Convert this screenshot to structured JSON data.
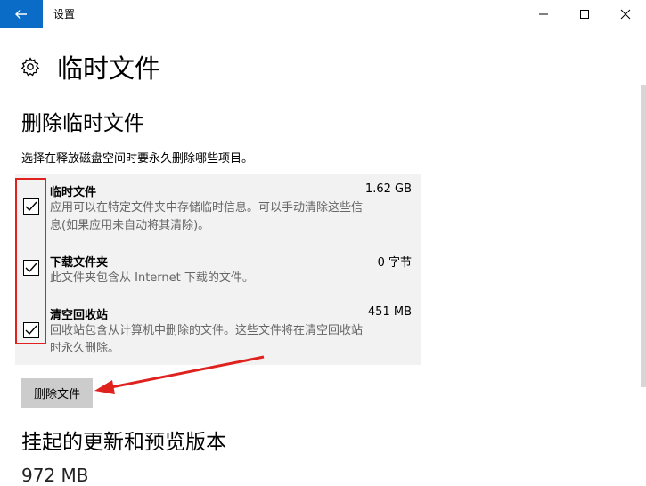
{
  "window": {
    "title": "设置"
  },
  "page": {
    "title": "临时文件"
  },
  "delete_section": {
    "title": "删除临时文件",
    "description": "选择在释放磁盘空间时要永久删除哪些项目。",
    "items": [
      {
        "name": "临时文件",
        "size": "1.62 GB",
        "desc_line1": "应用可以在特定文件夹中存储临时信息。可以手动清除这些信",
        "desc_line2": "息(如果应用未自动将其清除)。",
        "checked": true
      },
      {
        "name": "下载文件夹",
        "size": "0 字节",
        "desc_line1": "此文件夹包含从 Internet 下载的文件。",
        "desc_line2": "",
        "checked": true
      },
      {
        "name": "清空回收站",
        "size": "451 MB",
        "desc_line1": "回收站包含从计算机中删除的文件。这些文件将在清空回收站",
        "desc_line2": "时永久删除。",
        "checked": true
      }
    ],
    "delete_button": "删除文件"
  },
  "updates_section": {
    "title": "挂起的更新和预览版本",
    "size": "972 MB"
  },
  "colors": {
    "accent": "#0a6cc6",
    "highlight": "#e0221f"
  }
}
